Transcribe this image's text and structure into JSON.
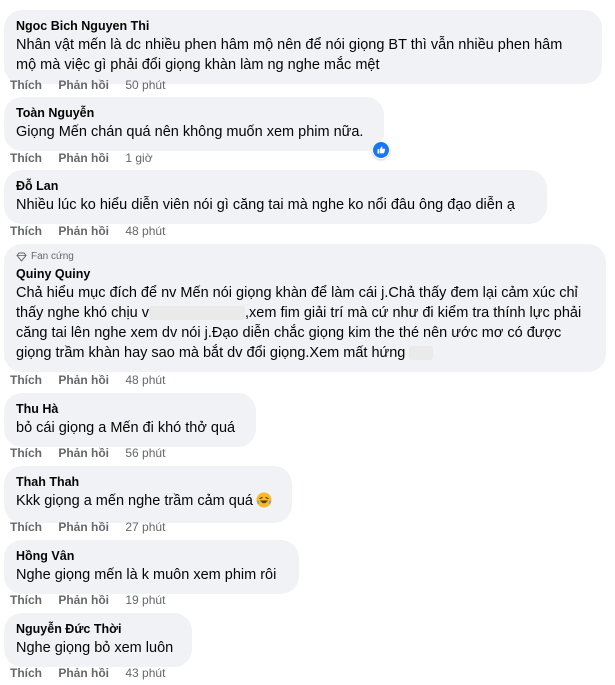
{
  "actions": {
    "like": "Thích",
    "reply": "Phản hồi"
  },
  "comments": [
    {
      "author": "Ngoc Bich Nguyen Thi",
      "lines": [
        "Nhân vật mến là dc nhiều phen hâm mộ nên để nói giọng BT thì vẫn nhiều phen hâm",
        "mộ mà việc gì phải đổi giọng khàn làm ng nghe mắc mệt"
      ],
      "time": "50 phút"
    },
    {
      "author": "Toàn Nguyễn",
      "lines": [
        "Giọng Mến chán quá nên không muốn xem phim nữa."
      ],
      "time": "1 giờ",
      "reaction": "like-icon"
    },
    {
      "author": "Đỗ Lan",
      "lines": [
        "Nhiều lúc ko hiểu diễn viên nói gì căng tai mà nghe ko nổi đâu ông đạo diễn ạ"
      ],
      "time": "48 phút"
    },
    {
      "badge": "Fan cứng",
      "author": "Quiny Quiny",
      "lines": [
        "Chả hiểu mục đích để nv Mến nói giọng khàn để làm cái j.Chả thấy đem lại cảm xúc chỉ",
        "thấy nghe khó chịu v",
        ",xem fim giải trí mà cứ như đi kiểm tra thính lực phải",
        "căng tai lên nghe xem dv nói j.Đạo diễn chắc giọng kim the thé nên ước mơ có được",
        "giọng trầm khàn hay sao mà bắt dv đổi giọng.Xem mất hứng"
      ],
      "time": "48 phút"
    },
    {
      "author": "Thu Hà",
      "lines": [
        "bỏ cái giọng a Mến đi khó thở quá"
      ],
      "time": "56 phút"
    },
    {
      "author": "Thah Thah",
      "lines": [
        "Kkk giọng a mến nghe trầm cảm quá"
      ],
      "time": "27 phút",
      "emoji": "laughing-emoji"
    },
    {
      "author": "Hồng Vân",
      "lines": [
        "Nghe giọng mến là k muôn xem phim rôi"
      ],
      "time": "19 phút"
    },
    {
      "author": "Nguyễn Đức Thời",
      "lines": [
        "Nghe giọng bỏ xem luôn"
      ],
      "time": "43 phút"
    }
  ],
  "colors": {
    "bubble": "#f0f2f5",
    "meta": "#65676b",
    "like": "#1877f2"
  }
}
